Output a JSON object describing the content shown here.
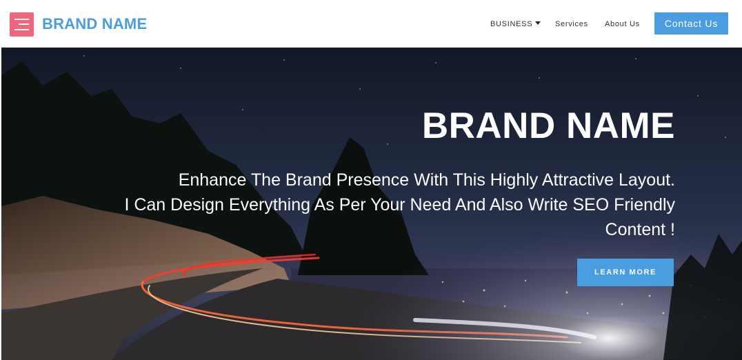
{
  "colors": {
    "accent": "#4a9de0",
    "logo_bg": "#f1667f",
    "hero_sky_top": "#141b2d",
    "hero_sky_bottom": "#39435f"
  },
  "header": {
    "logo_icon": "menu-icon",
    "brand": "BRAND NAME",
    "nav": [
      {
        "label": "BUSINESS",
        "has_dropdown": true,
        "icon": "caret-down-icon"
      },
      {
        "label": "Services"
      },
      {
        "label": "About Us"
      }
    ],
    "contact_label": "Contact Us"
  },
  "hero": {
    "title": "BRAND NAME",
    "lines": [
      "Enhance The Brand Presence With This Highly Attractive Layout.",
      "I Can Design Everything As Per Your Need And Also Write SEO Friendly",
      "Content !"
    ],
    "cta_label": "LEARN MORE"
  }
}
